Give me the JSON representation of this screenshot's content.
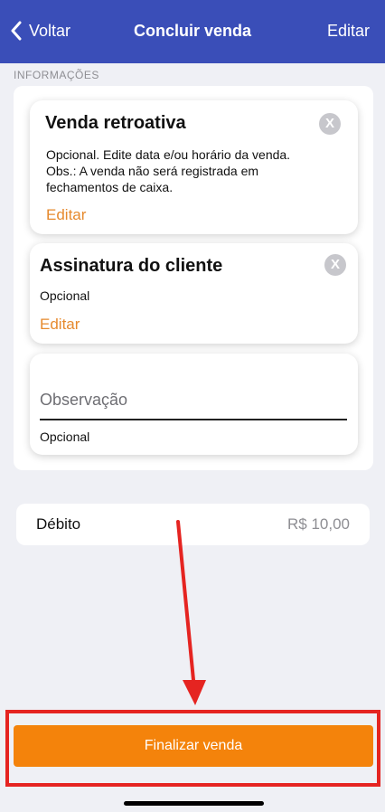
{
  "navbar": {
    "back_label": "Voltar",
    "title": "Concluir venda",
    "edit_label": "Editar",
    "background": "#3a4eb8"
  },
  "section": {
    "header": "INFORMAÇÕES"
  },
  "cards": {
    "retro": {
      "title": "Venda retroativa",
      "line1": "Opcional. Edite data e/ou horário da venda.",
      "line2": "Obs.: A venda não será registrada em",
      "line3": "fechamentos de caixa.",
      "edit_label": "Editar",
      "close_glyph": "X"
    },
    "signature": {
      "title": "Assinatura do cliente",
      "subtitle": "Opcional",
      "edit_label": "Editar",
      "close_glyph": "X"
    },
    "observation": {
      "placeholder": "Observação",
      "value": "",
      "subtitle": "Opcional"
    }
  },
  "payment": {
    "method": "Débito",
    "amount": "R$ 10,00"
  },
  "footer": {
    "finalize_label": "Finalizar venda",
    "button_color": "#f4830b",
    "annotation_color": "#e52421"
  },
  "icons": {
    "back": "chevron-left-icon",
    "close": "close-icon",
    "annotation": "arrow-down-icon"
  }
}
